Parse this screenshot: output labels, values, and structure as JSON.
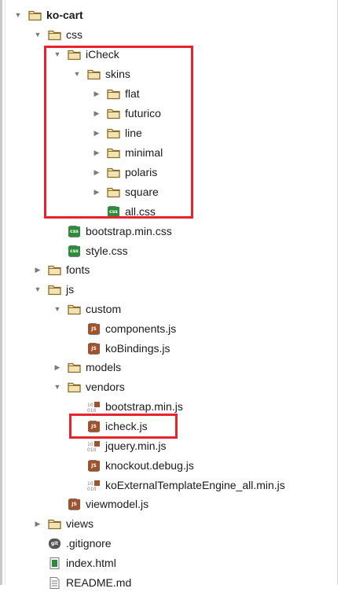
{
  "tree": [
    {
      "label": "ko-cart",
      "type": "folder",
      "expanded": true,
      "bold": true
    },
    {
      "label": "css",
      "type": "folder",
      "expanded": true
    },
    {
      "label": "iCheck",
      "type": "folder",
      "expanded": true
    },
    {
      "label": "skins",
      "type": "folder",
      "expanded": true
    },
    {
      "label": "flat",
      "type": "folder",
      "expanded": false
    },
    {
      "label": "futurico",
      "type": "folder",
      "expanded": false
    },
    {
      "label": "line",
      "type": "folder",
      "expanded": false
    },
    {
      "label": "minimal",
      "type": "folder",
      "expanded": false
    },
    {
      "label": "polaris",
      "type": "folder",
      "expanded": false
    },
    {
      "label": "square",
      "type": "folder",
      "expanded": false
    },
    {
      "label": "all.css",
      "type": "css"
    },
    {
      "label": "bootstrap.min.css",
      "type": "css"
    },
    {
      "label": "style.css",
      "type": "css"
    },
    {
      "label": "fonts",
      "type": "folder",
      "expanded": false
    },
    {
      "label": "js",
      "type": "folder",
      "expanded": true
    },
    {
      "label": "custom",
      "type": "folder",
      "expanded": true
    },
    {
      "label": "components.js",
      "type": "js"
    },
    {
      "label": "koBindings.js",
      "type": "js"
    },
    {
      "label": "models",
      "type": "folder",
      "expanded": false
    },
    {
      "label": "vendors",
      "type": "folder",
      "expanded": true
    },
    {
      "label": "bootstrap.min.js",
      "type": "minjs"
    },
    {
      "label": "icheck.js",
      "type": "js"
    },
    {
      "label": "jquery.min.js",
      "type": "minjs"
    },
    {
      "label": "knockout.debug.js",
      "type": "js"
    },
    {
      "label": "koExternalTemplateEngine_all.min.js",
      "type": "minjs"
    },
    {
      "label": "viewmodel.js",
      "type": "js"
    },
    {
      "label": "views",
      "type": "folder",
      "expanded": false
    },
    {
      "label": ".gitignore",
      "type": "git"
    },
    {
      "label": "index.html",
      "type": "html"
    },
    {
      "label": "README.md",
      "type": "md"
    }
  ],
  "icons": {
    "css_badge": "css",
    "js_badge": "JS",
    "git_badge": "git"
  },
  "colors": {
    "highlight": "#e5242e",
    "folder_stroke": "#8a6d2b",
    "folder_fill": "#f3e3b3",
    "css_green": "#2e8b3a",
    "js_brown": "#a0522d"
  }
}
